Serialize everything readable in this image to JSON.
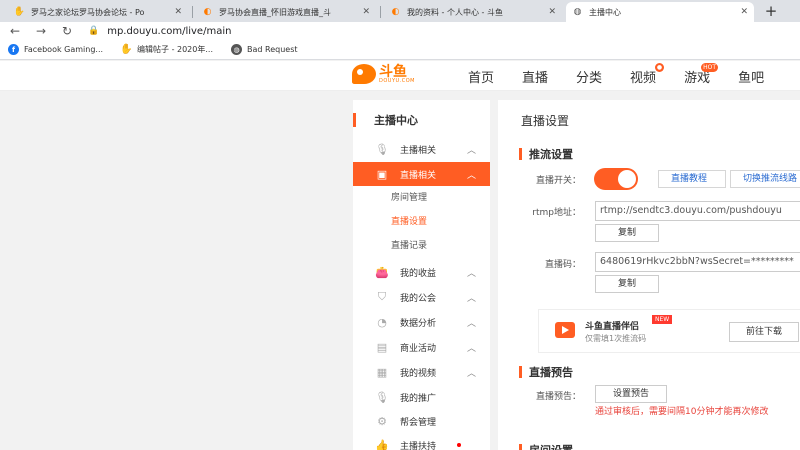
{
  "browser": {
    "tabs": [
      {
        "title": "罗马之家论坛罗马协会论坛 - Po",
        "icon": "hand-icon"
      },
      {
        "title": "罗马协会直播_怀旧游戏直播_斗",
        "icon": "douyu-icon"
      },
      {
        "title": "我的资料 - 个人中心 - 斗鱼",
        "icon": "douyu-icon"
      },
      {
        "title": "主播中心",
        "icon": "globe-icon"
      }
    ],
    "new_tab": "+",
    "url": "mp.douyu.com/live/main",
    "bookmarks": [
      {
        "label": "Facebook Gaming...",
        "icon": "facebook-icon"
      },
      {
        "label": "编辑帖子 - 2020年...",
        "icon": "hand-icon"
      },
      {
        "label": "Bad Request",
        "icon": "globe-icon"
      }
    ]
  },
  "header": {
    "logo_main": "斗鱼",
    "logo_sub": "DOUYU.COM",
    "nav": [
      {
        "label": "首页"
      },
      {
        "label": "直播"
      },
      {
        "label": "分类"
      },
      {
        "label": "视频",
        "badge": "●"
      },
      {
        "label": "游戏",
        "badge": "HOT"
      },
      {
        "label": "鱼吧"
      }
    ]
  },
  "sidebar": {
    "title": "主播中心",
    "items": [
      {
        "label": "主播相关",
        "icon": "microphone-icon",
        "expanded": false
      },
      {
        "label": "直播相关",
        "icon": "video-icon",
        "active": true
      },
      {
        "label": "我的收益",
        "icon": "wallet-icon"
      },
      {
        "label": "我的公会",
        "icon": "shield-icon"
      },
      {
        "label": "数据分析",
        "icon": "pie-chart-icon"
      },
      {
        "label": "商业活动",
        "icon": "building-icon"
      },
      {
        "label": "我的视频",
        "icon": "calendar-icon"
      },
      {
        "label": "我的推广",
        "icon": "microphone-icon"
      },
      {
        "label": "帮会管理",
        "icon": "gear-icon"
      },
      {
        "label": "主播扶持",
        "icon": "thumbs-up-icon"
      }
    ],
    "sub_items": [
      {
        "label": "房间管理"
      },
      {
        "label": "直播设置",
        "active": true
      },
      {
        "label": "直播记录"
      }
    ]
  },
  "main": {
    "page_title": "直播设置",
    "section_stream": "推流设置",
    "switch_label": "直播开关：",
    "switch_on": true,
    "tutorial_link": "直播教程",
    "switch_line_link": "切换推流线路",
    "rtmp_label": "rtmp地址：",
    "rtmp_value": "rtmp://sendtc3.douyu.com/pushdouyu",
    "copy_label": "复制",
    "code_label": "直播码：",
    "code_value": "6480619rHkvc2bbN?wsSecret=*********",
    "promo_title": "斗鱼直播伴侣",
    "promo_badge": "NEW",
    "promo_sub": "仅需填1次推流码",
    "promo_download": "前往下载",
    "section_preview": "直播预告",
    "preview_label": "直播预告：",
    "preview_button": "设置预告",
    "preview_warning": "通过审核后，需要间隔10分钟才能再次修改",
    "section_room": "房间设置"
  }
}
